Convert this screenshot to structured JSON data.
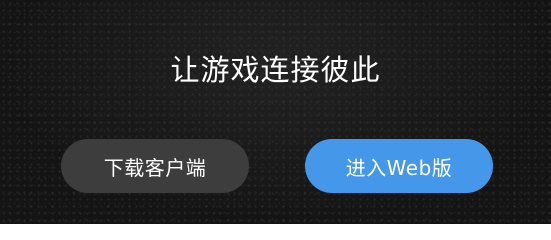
{
  "hero": {
    "headline": "让游戏连接彼此"
  },
  "buttons": {
    "download_label": "下载客户端",
    "web_label": "进入Web版"
  },
  "colors": {
    "background": "#141414",
    "download_button": "#3d3d3d",
    "web_button": "#4597ea",
    "text": "#ffffff"
  }
}
